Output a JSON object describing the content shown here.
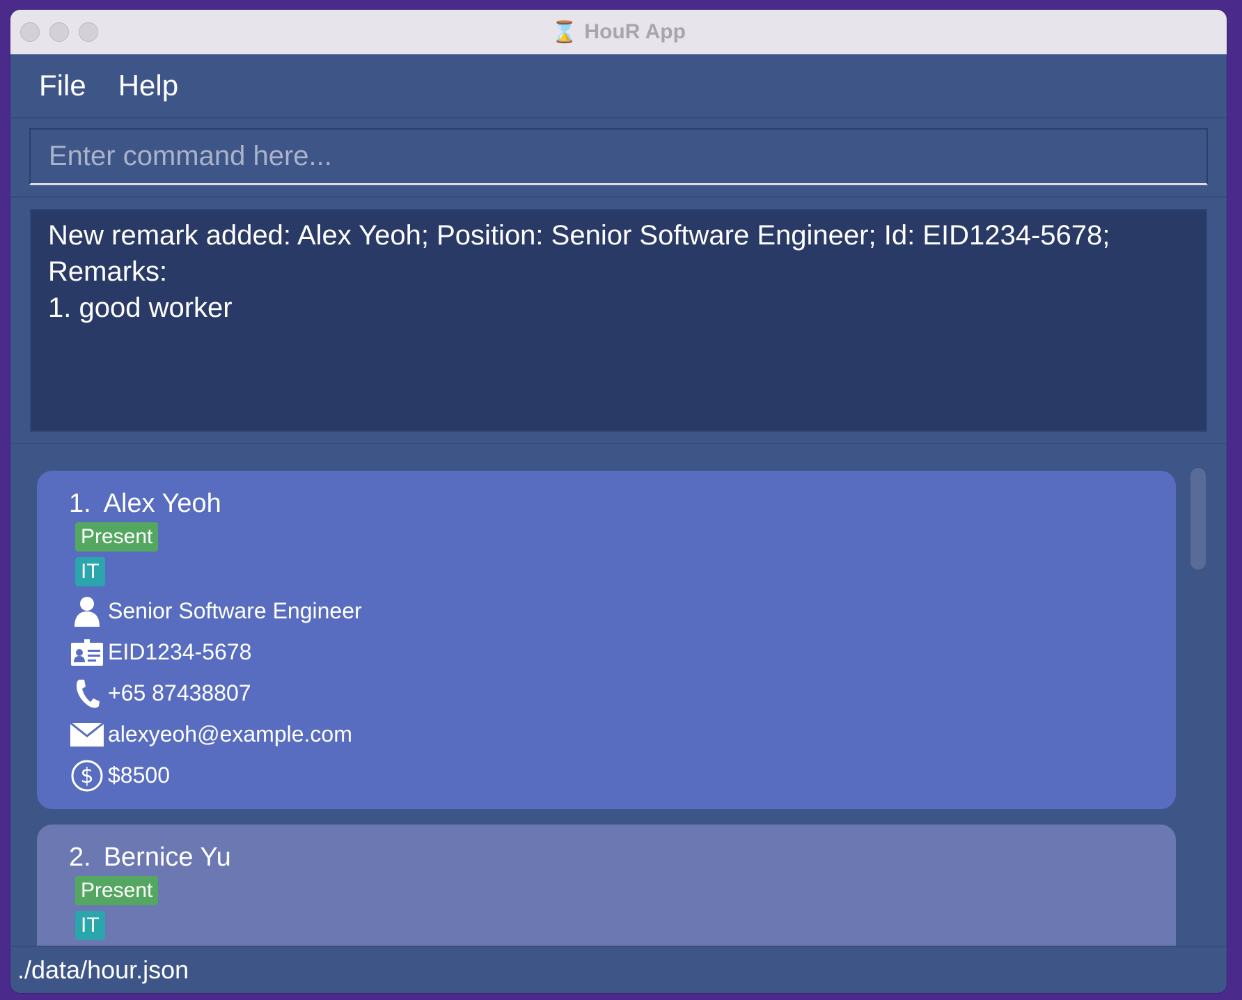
{
  "window": {
    "title": "HouR App",
    "title_icon": "hourglass-icon"
  },
  "menu": {
    "file_label": "File",
    "help_label": "Help"
  },
  "command": {
    "placeholder": "Enter command here...",
    "value": ""
  },
  "result": {
    "text": "New remark added: Alex Yeoh; Position: Senior Software Engineer; Id: EID1234-5678;\nRemarks:\n1. good worker"
  },
  "employees": [
    {
      "index": "1.",
      "name": "Alex Yeoh",
      "status_tag": "Present",
      "department_tag": "IT",
      "position": "Senior Software Engineer",
      "id": "EID1234-5678",
      "phone": "+65 87438807",
      "email": "alexyeoh@example.com",
      "salary": "$8500",
      "selected": true
    },
    {
      "index": "2.",
      "name": "Bernice Yu",
      "status_tag": "Present",
      "department_tag": "IT",
      "selected": false
    }
  ],
  "status_bar": {
    "file_path": "./data/hour.json"
  },
  "colors": {
    "background": "#3e5587",
    "result_box": "#293a66",
    "card_selected": "#586dbf",
    "card_normal": "#6b78b2",
    "tag_present": "#54a760",
    "tag_department": "#2aa6ac"
  }
}
